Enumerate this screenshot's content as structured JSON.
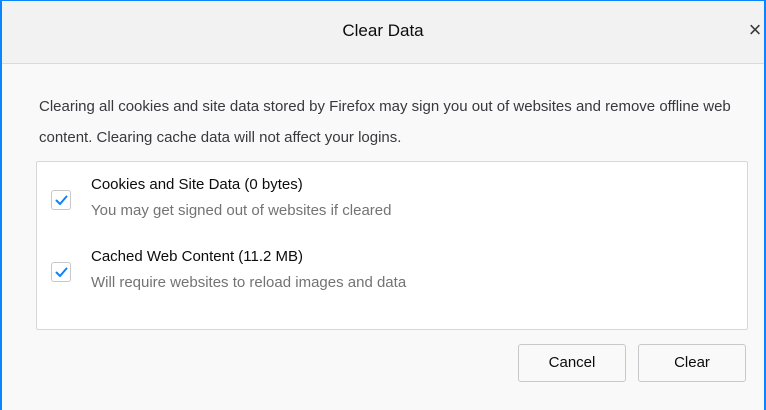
{
  "dialog": {
    "title": "Clear Data",
    "close_symbol": "×",
    "close_icon": "close-icon",
    "description": "Clearing all cookies and site data stored by Firefox may sign you out of websites and remove offline web content. Clearing cache data will not affect your logins.",
    "options": [
      {
        "label": "Cookies and Site Data (0 bytes)",
        "description": "You may get signed out of websites if cleared",
        "checked": true
      },
      {
        "label": "Cached Web Content (11.2 MB)",
        "description": "Will require websites to reload images and data",
        "checked": true
      }
    ],
    "buttons": {
      "cancel_label": "Cancel",
      "clear_label": "Clear"
    },
    "colors": {
      "accent": "#0a84ff",
      "checkmark": "#0a84ff"
    }
  }
}
